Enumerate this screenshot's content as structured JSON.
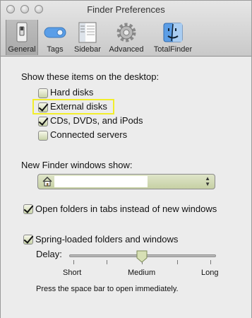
{
  "window": {
    "title": "Finder Preferences"
  },
  "toolbar": {
    "items": [
      {
        "label": "General",
        "icon": "general-switch-icon",
        "selected": true
      },
      {
        "label": "Tags",
        "icon": "tags-icon",
        "selected": false
      },
      {
        "label": "Sidebar",
        "icon": "sidebar-icon",
        "selected": false
      },
      {
        "label": "Advanced",
        "icon": "gear-icon",
        "selected": false
      },
      {
        "label": "TotalFinder",
        "icon": "totalfinder-icon",
        "selected": false
      }
    ]
  },
  "desktop": {
    "heading": "Show these items on the desktop:",
    "items": [
      {
        "label": "Hard disks",
        "checked": false
      },
      {
        "label": "External disks",
        "checked": true,
        "highlighted": true
      },
      {
        "label": "CDs, DVDs, and iPods",
        "checked": true
      },
      {
        "label": "Connected servers",
        "checked": false
      }
    ]
  },
  "new_window": {
    "heading": "New Finder windows show:",
    "selected_value": "",
    "icon": "home-icon"
  },
  "options": {
    "open_in_tabs": {
      "label": "Open folders in tabs instead of new windows",
      "checked": true
    },
    "spring_loaded": {
      "label": "Spring-loaded folders and windows",
      "checked": true
    }
  },
  "delay": {
    "label": "Delay:",
    "ticks": [
      "Short",
      "Medium",
      "Long"
    ],
    "value_fraction": 0.5,
    "hint": "Press the space bar to open immediately."
  }
}
